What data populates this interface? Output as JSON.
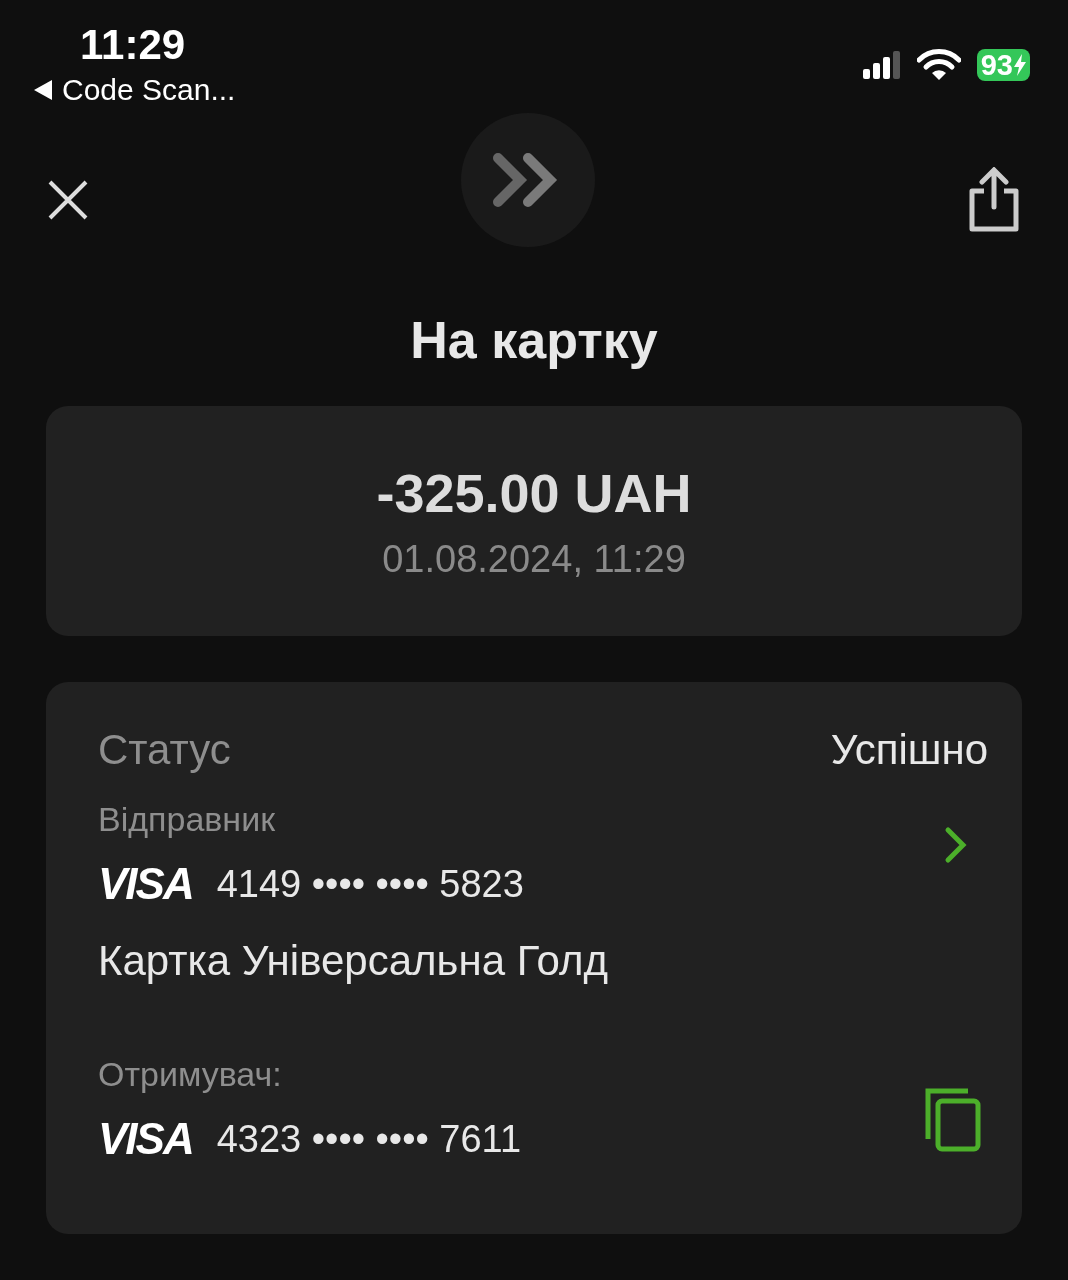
{
  "status_bar": {
    "time": "11:29",
    "back_label": "Code Scan...",
    "battery": "93"
  },
  "title": "На картку",
  "amount": {
    "value": "-325.00 UAH",
    "datetime": "01.08.2024, 11:29"
  },
  "details": {
    "status_label": "Статус",
    "status_value": "Успішно",
    "sender": {
      "label": "Відправник",
      "brand": "VISA",
      "number": "4149 •••• •••• 5823",
      "card_name": "Картка Універсальна Голд"
    },
    "recipient": {
      "label": "Отримувач:",
      "brand": "VISA",
      "number": "4323 •••• •••• 7611"
    }
  }
}
